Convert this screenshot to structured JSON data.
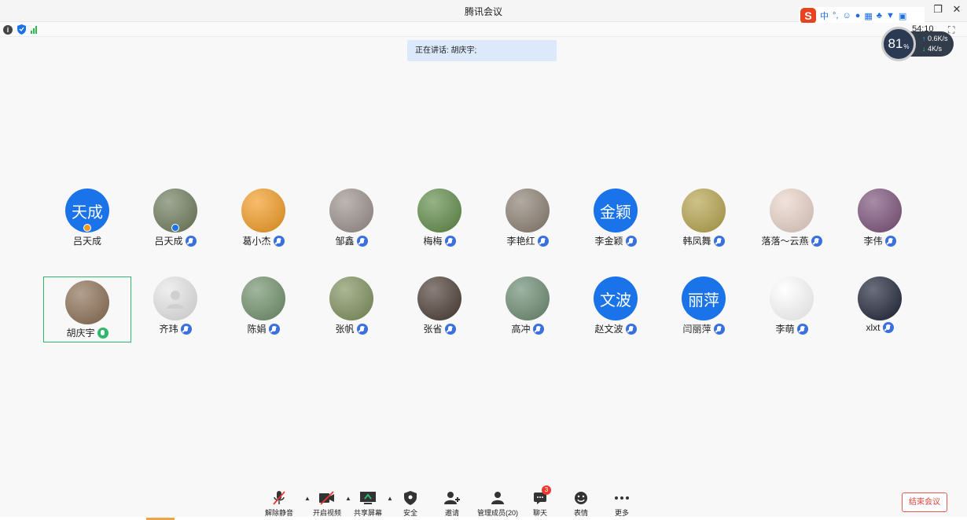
{
  "window": {
    "title": "腾讯会议",
    "controls": [
      "restore-icon",
      "close-icon"
    ]
  },
  "ime": {
    "brand": "S",
    "items": [
      "中",
      "°,",
      "☺",
      "mic",
      "kbd",
      "⚙",
      "shirt",
      "grid"
    ]
  },
  "status": {
    "icons": [
      "info-icon",
      "shield-icon",
      "signal-icon"
    ],
    "timer": "54:10"
  },
  "speed": {
    "percent": "81",
    "percent_unit": "%",
    "upload": "0.6",
    "upload_unit": "K/s",
    "download": "4",
    "download_unit": "K/s"
  },
  "speaking": {
    "text": "正在讲话: 胡庆宇;"
  },
  "participants": [
    {
      "name": "吕天成",
      "avatar_text": "天成",
      "avatar_color": "#1a73e8",
      "mic": "none",
      "badge": "#f39a1f"
    },
    {
      "name": "吕天成",
      "avatar_text": "",
      "avatar_color": "#6d7a5a",
      "mic": "muted",
      "badge": "#1a73e8"
    },
    {
      "name": "葛小杰",
      "avatar_text": "",
      "avatar_color": "#f39a1f",
      "mic": "muted"
    },
    {
      "name": "邹鑫",
      "avatar_text": "",
      "avatar_color": "#9a8f8a",
      "mic": "muted"
    },
    {
      "name": "梅梅",
      "avatar_text": "",
      "avatar_color": "#5e8a46",
      "mic": "muted"
    },
    {
      "name": "李艳红",
      "avatar_text": "",
      "avatar_color": "#8a7d70",
      "mic": "muted"
    },
    {
      "name": "李金颖",
      "avatar_text": "金颖",
      "avatar_color": "#1a73e8",
      "mic": "muted"
    },
    {
      "name": "韩凤舞",
      "avatar_text": "",
      "avatar_color": "#b5a24a",
      "mic": "muted"
    },
    {
      "name": "落落～云燕",
      "avatar_text": "",
      "avatar_color": "#e9d3c8",
      "mic": "muted"
    },
    {
      "name": "李伟",
      "avatar_text": "",
      "avatar_color": "#7a4f78",
      "mic": "muted"
    },
    {
      "name": "胡庆宇",
      "avatar_text": "",
      "avatar_color": "#8a6d52",
      "mic": "speaking",
      "active": true
    },
    {
      "name": "齐玮",
      "avatar_text": "",
      "avatar_color": "#e6e6e6",
      "mic": "muted"
    },
    {
      "name": "陈娟",
      "avatar_text": "",
      "avatar_color": "#6f8f6a",
      "mic": "muted"
    },
    {
      "name": "张帆",
      "avatar_text": "",
      "avatar_color": "#7d8f5a",
      "mic": "muted"
    },
    {
      "name": "张省",
      "avatar_text": "",
      "avatar_color": "#4a3a32",
      "mic": "muted"
    },
    {
      "name": "高冲",
      "avatar_text": "",
      "avatar_color": "#6a8a70",
      "mic": "muted"
    },
    {
      "name": "赵文波",
      "avatar_text": "文波",
      "avatar_color": "#1a73e8",
      "mic": "muted"
    },
    {
      "name": "闫丽萍",
      "avatar_text": "丽萍",
      "avatar_color": "#1a73e8",
      "mic": "muted"
    },
    {
      "name": "李萌",
      "avatar_text": "",
      "avatar_color": "#ffffff",
      "mic": "muted"
    },
    {
      "name": "xlxt",
      "avatar_text": "",
      "avatar_color": "#1c2236",
      "mic": "muted"
    }
  ],
  "toolbar": [
    {
      "key": "unmute",
      "label": "解除静音",
      "icon": "mic-muted-icon",
      "caret": true
    },
    {
      "key": "video",
      "label": "开启视频",
      "icon": "camera-off-icon",
      "caret": true
    },
    {
      "key": "share",
      "label": "共享屏幕",
      "icon": "share-screen-icon",
      "caret": true
    },
    {
      "key": "security",
      "label": "安全",
      "icon": "shield-icon"
    },
    {
      "key": "invite",
      "label": "邀请",
      "icon": "add-user-icon"
    },
    {
      "key": "members",
      "label": "管理成员(20)",
      "icon": "members-icon"
    },
    {
      "key": "chat",
      "label": "聊天",
      "icon": "chat-icon",
      "badge": "3"
    },
    {
      "key": "reactions",
      "label": "表情",
      "icon": "smile-icon"
    },
    {
      "key": "more",
      "label": "更多",
      "icon": "more-icon"
    }
  ],
  "end_meeting": {
    "label": "结束会议"
  }
}
